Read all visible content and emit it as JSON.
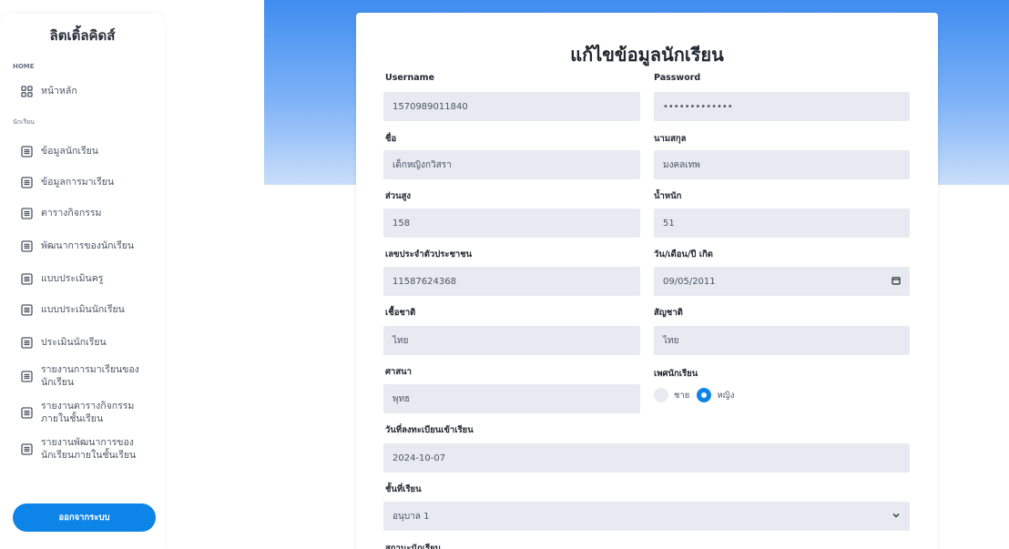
{
  "sidebar": {
    "brand": "ลิตเติ้ลคิดส์",
    "section_home": "HOME",
    "home_item": "หน้าหลัก",
    "section_student": "นักเรียน",
    "items": [
      {
        "label": "ข้อมูลนักเรียน"
      },
      {
        "label": "ข้อมูลการมาเรียน"
      },
      {
        "label": "ตารางกิจกรรม"
      },
      {
        "label": "พัฒนาการของนักเรียน"
      },
      {
        "label": "แบบประเมินครู"
      },
      {
        "label": "แบบประเมินนักเรียน"
      },
      {
        "label": "ประเมินนักเรียน"
      },
      {
        "label": "รายงานการมาเรียนของนักเรียน"
      },
      {
        "label": "รายงานตารางกิจกรรมภายในชั้นเรียน"
      },
      {
        "label": "รายงานพัฒนาการของนักเรียนภายในชั้นเรียน"
      }
    ],
    "logout": "ออกจากระบบ"
  },
  "form": {
    "title": "แก้ไขข้อมูลนักเรียน",
    "username_label": "Username",
    "username_value": "1570989011840",
    "password_label": "Password",
    "password_value": "•••••••••••••",
    "firstname_label": "ชื่อ",
    "firstname_value": "เด็กหญิงกวิสรา",
    "lastname_label": "นามสกุล",
    "lastname_value": "มงคลเทพ",
    "height_label": "ส่วนสูง",
    "height_value": "158",
    "weight_label": "น้ำหนัก",
    "weight_value": "51",
    "idcard_label": "เลขประจำตัวประชาชน",
    "idcard_value": "11587624368",
    "birthdate_label": "วัน/เดือน/ปี เกิด",
    "birthdate_value": "09/05/2011",
    "ethnicity_label": "เชื้อชาติ",
    "ethnicity_value": "ไทย",
    "nationality_label": "สัญชาติ",
    "nationality_value": "ไทย",
    "religion_label": "ศาสนา",
    "religion_value": "พุทธ",
    "gender_label": "เพศนักเรียน",
    "gender_male": "ชาย",
    "gender_female": "หญิง",
    "gender_selected": "หญิง",
    "enroll_label": "วันที่ลงทะเบียนเข้าเรียน",
    "enroll_value": "2024-10-07",
    "class_label": "ชั้นที่เรียน",
    "class_value": "อนุบาล 1",
    "status_label": "สถานะนักเรียน"
  },
  "colors": {
    "accent": "#0c84e8",
    "banner_top": "#3f8df0",
    "field_bg": "#e7eaf0"
  }
}
